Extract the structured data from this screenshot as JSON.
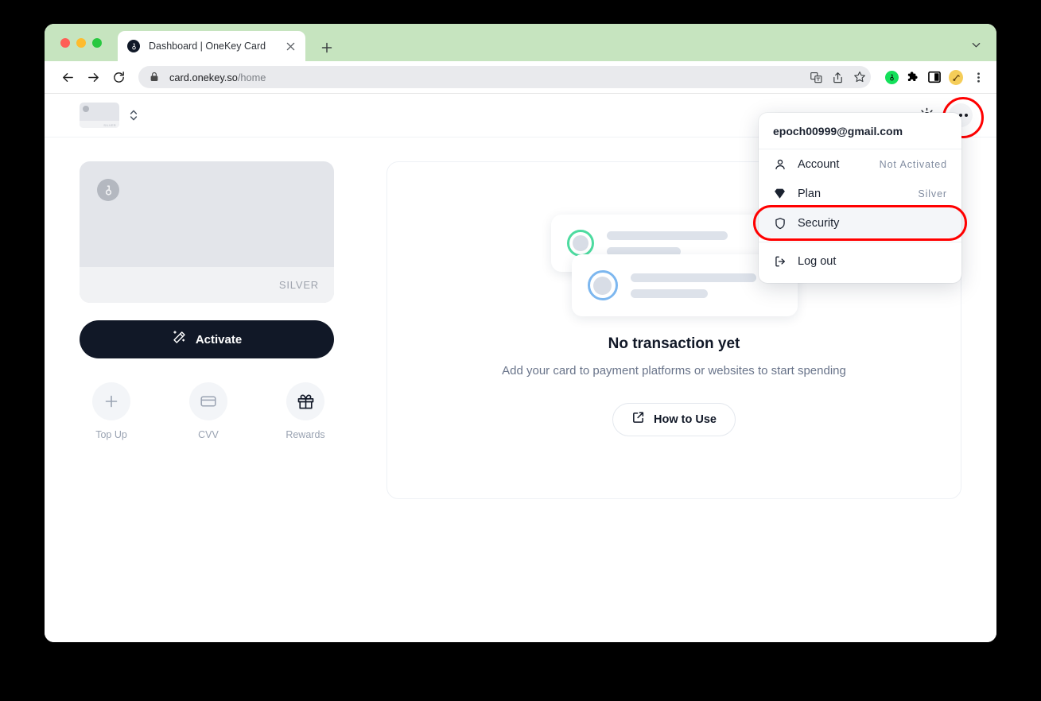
{
  "browser": {
    "tab": {
      "title": "Dashboard | OneKey Card",
      "favicon": "onekey-logo-icon"
    },
    "new_tab_label": "+",
    "address_bar": {
      "domain": "card.onekey.so",
      "path": "/home"
    },
    "nav": {
      "back": "back-arrow-icon",
      "forward": "forward-arrow-icon",
      "reload": "reload-icon"
    },
    "omnibox_actions": [
      "translate-icon",
      "share-icon",
      "bookmark-star-icon"
    ],
    "extensions": [
      "onekey-extension-icon",
      "puzzle-extensions-icon",
      "sidebar-panel-icon",
      "profile-avatar-icon"
    ],
    "menu": "browser-menu-icon"
  },
  "app": {
    "header": {
      "card_selector": {
        "tier_label": "SILVER",
        "chevron": "chevron-updown-icon"
      },
      "theme_toggle": "sun-icon",
      "more_menu": "ellipsis-icon"
    },
    "card": {
      "tier": "SILVER",
      "logo": "onekey-logo-icon"
    },
    "activate_button": {
      "label": "Activate",
      "icon": "magic-wand-icon"
    },
    "quick_actions": [
      {
        "label": "Top Up",
        "icon": "plus-icon",
        "enabled": false
      },
      {
        "label": "CVV",
        "icon": "credit-card-icon",
        "enabled": false
      },
      {
        "label": "Rewards",
        "icon": "gift-icon",
        "enabled": true
      }
    ],
    "transactions": {
      "empty_title": "No transaction yet",
      "empty_subtitle": "Add your card to payment platforms or websites to start spending",
      "how_to_use": {
        "label": "How to Use",
        "icon": "external-link-icon"
      }
    },
    "account_menu": {
      "email": "epoch00999@gmail.com",
      "items": [
        {
          "label": "Account",
          "value": "Not Activated",
          "icon": "person-icon",
          "highlighted": false
        },
        {
          "label": "Plan",
          "value": "Silver",
          "icon": "diamond-icon",
          "highlighted": false
        },
        {
          "label": "Security",
          "value": "",
          "icon": "shield-icon",
          "highlighted": true
        },
        {
          "label": "Log out",
          "value": "",
          "icon": "logout-icon",
          "highlighted": false
        }
      ]
    }
  },
  "colors": {
    "accent_dark": "#111827",
    "highlight_ring": "#ff0000",
    "tab_strip": "#c6e4bf",
    "skeleton_green": "#4ddba0",
    "skeleton_blue": "#7db7ef"
  }
}
